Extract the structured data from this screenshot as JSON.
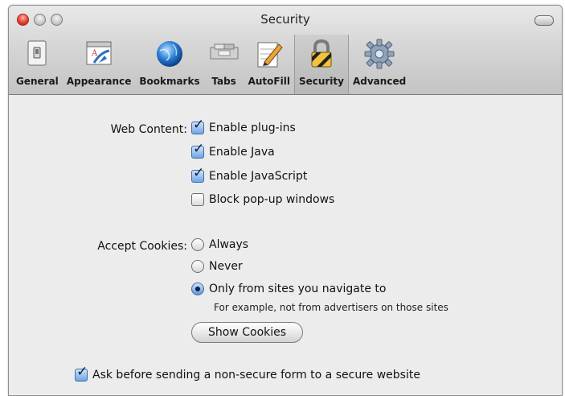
{
  "window": {
    "title": "Security"
  },
  "toolbar": {
    "items": [
      {
        "label": "General",
        "icon": "light-switch-icon"
      },
      {
        "label": "Appearance",
        "icon": "font-panel-icon"
      },
      {
        "label": "Bookmarks",
        "icon": "globe-icon"
      },
      {
        "label": "Tabs",
        "icon": "tabs-icon"
      },
      {
        "label": "AutoFill",
        "icon": "pencil-paper-icon"
      },
      {
        "label": "Security",
        "icon": "padlock-icon",
        "selected": true
      },
      {
        "label": "Advanced",
        "icon": "gear-icon"
      }
    ]
  },
  "web_content": {
    "label": "Web Content:",
    "options": [
      {
        "label": "Enable plug-ins",
        "checked": true
      },
      {
        "label": "Enable Java",
        "checked": true
      },
      {
        "label": "Enable JavaScript",
        "checked": true
      },
      {
        "label": "Block pop-up windows",
        "checked": false
      }
    ]
  },
  "cookies": {
    "label": "Accept Cookies:",
    "options": [
      {
        "label": "Always",
        "selected": false
      },
      {
        "label": "Never",
        "selected": false
      },
      {
        "label": "Only from sites you navigate to",
        "selected": true
      }
    ],
    "hint": "For example, not from advertisers on those sites",
    "show_button": "Show Cookies"
  },
  "nonsecure_form": {
    "label": "Ask before sending a non-secure form to a secure website",
    "checked": true
  },
  "colors": {
    "accent": "#5d96db",
    "checkmark": "#0d1f3c",
    "selected_tab": "#b7b7b7"
  }
}
